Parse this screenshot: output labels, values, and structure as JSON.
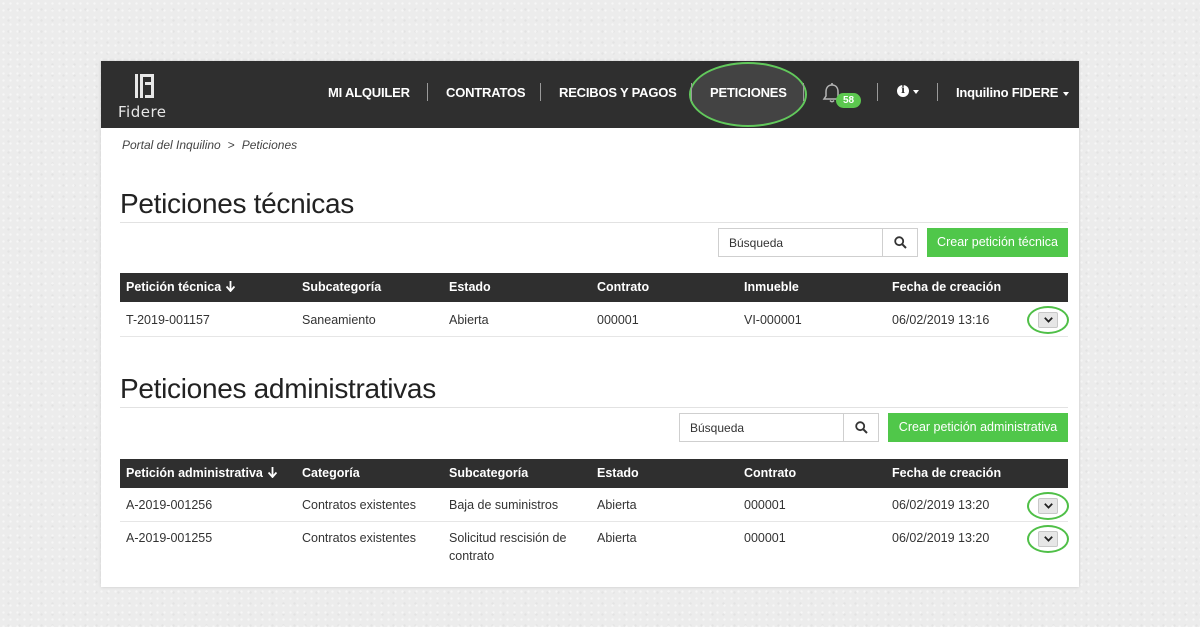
{
  "brand": {
    "name": "Fidere",
    "logo_icon": "fidere-logo-icon"
  },
  "nav": {
    "items": [
      {
        "label": "MI ALQUILER"
      },
      {
        "label": "CONTRATOS"
      },
      {
        "label": "RECIBOS Y PAGOS"
      },
      {
        "label": "PETICIONES",
        "active": true
      }
    ],
    "notifications_count": "58",
    "notifications_icon": "bell-icon",
    "info_icon": "info-icon",
    "user_label": "Inquilino FIDERE"
  },
  "breadcrumb": {
    "items": [
      "Portal del Inquilino",
      "Peticiones"
    ],
    "separator": ">"
  },
  "technical": {
    "title": "Peticiones técnicas",
    "search_placeholder": "Búsqueda",
    "create_label": "Crear petición técnica",
    "columns": [
      "Petición técnica",
      "Subcategoría",
      "Estado",
      "Contrato",
      "Inmueble",
      "Fecha de creación"
    ],
    "rows": [
      [
        "T-2019-001157",
        "Saneamiento",
        "Abierta",
        "000001",
        "VI-000001",
        "06/02/2019 13:16"
      ]
    ]
  },
  "administrative": {
    "title": "Peticiones administrativas",
    "search_placeholder": "Búsqueda",
    "create_label": "Crear petición administrativa",
    "columns": [
      "Petición administrativa",
      "Categoría",
      "Subcategoría",
      "Estado",
      "Contrato",
      "Fecha de creación"
    ],
    "rows": [
      [
        "A-2019-001256",
        "Contratos existentes",
        "Baja de suministros",
        "Abierta",
        "000001",
        "06/02/2019 13:20"
      ],
      [
        "A-2019-001255",
        "Contratos existentes",
        "Solicitud rescisión de contrato",
        "Abierta",
        "000001",
        "06/02/2019 13:20"
      ]
    ]
  },
  "colors": {
    "accent_green": "#50c74a",
    "navbar": "#2f2f2f",
    "highlight": "#5ac85a"
  }
}
